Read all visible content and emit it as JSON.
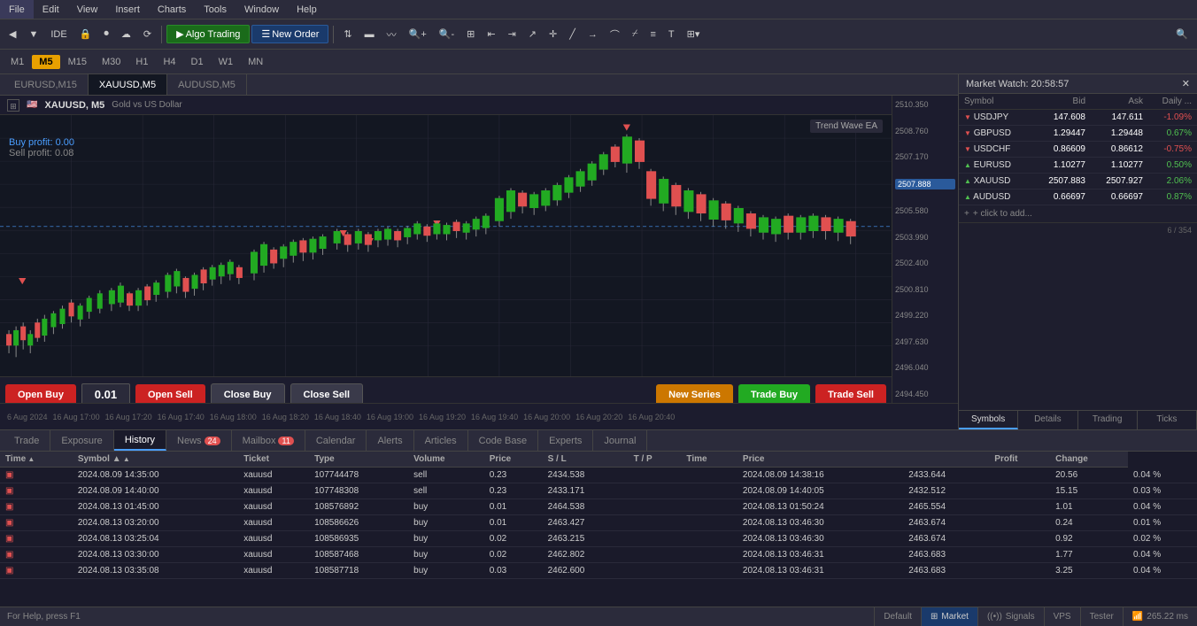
{
  "menubar": {
    "items": [
      "File",
      "Edit",
      "View",
      "Insert",
      "Charts",
      "Tools",
      "Window",
      "Help"
    ]
  },
  "toolbar": {
    "algo_trading": "Algo Trading",
    "new_order": "New Order"
  },
  "timeframes": {
    "items": [
      "M1",
      "M5",
      "M15",
      "M30",
      "H1",
      "H4",
      "D1",
      "W1",
      "MN"
    ],
    "active": "M5"
  },
  "chart": {
    "pair": "XAUUSD, M5",
    "full_name": "Gold vs US Dollar",
    "ea": "Trend Wave EA",
    "buy_profit_label": "Buy profit: 0.00",
    "sell_profit_label": "Sell profit: 0.08",
    "price_high": "2510.350",
    "price_levels": [
      "2510.350",
      "2508.760",
      "2507.170",
      "2505.580",
      "2503.990",
      "2502.400",
      "2500.810",
      "2499.220",
      "2497.630",
      "2496.040",
      "2494.450"
    ],
    "current_price": "2507.888",
    "timestamps": [
      "6 Aug 2024",
      "16 Aug 17:00",
      "16 Aug 17:20",
      "16 Aug 17:40",
      "16 Aug 18:00",
      "16 Aug 18:20",
      "16 Aug 18:40",
      "16 Aug 19:00",
      "16 Aug 19:20",
      "16 Aug 19:40",
      "16 Aug 20:00",
      "16 Aug 20:20",
      "16 Aug 20:40"
    ]
  },
  "chart_tabs": [
    {
      "label": "EURUSD,M15",
      "active": false
    },
    {
      "label": "XAUUSD,M5",
      "active": true
    },
    {
      "label": "AUDUSD,M5",
      "active": false
    }
  ],
  "action_bar": {
    "open_buy": "Open Buy",
    "lot_size": "0.01",
    "open_sell": "Open Sell",
    "close_buy": "Close Buy",
    "close_sell": "Close Sell",
    "new_series": "New Series",
    "trade_buy": "Trade Buy",
    "trade_sell": "Trade Sell"
  },
  "market_watch": {
    "title": "Market Watch: 20:58:57",
    "columns": [
      "Symbol",
      "Bid",
      "Ask",
      "Daily ..."
    ],
    "rows": [
      {
        "arrow": "down",
        "symbol": "USDJPY",
        "bid": "147.608",
        "ask": "147.611",
        "daily": "-1.09%",
        "color": "red"
      },
      {
        "arrow": "down",
        "symbol": "GBPUSD",
        "bid": "1.29447",
        "ask": "1.29448",
        "daily": "0.67%",
        "color": "green"
      },
      {
        "arrow": "down",
        "symbol": "USDCHF",
        "bid": "0.86609",
        "ask": "0.86612",
        "daily": "-0.75%",
        "color": "red"
      },
      {
        "arrow": "up",
        "symbol": "EURUSD",
        "bid": "1.10277",
        "ask": "1.10277",
        "daily": "0.50%",
        "color": "green"
      },
      {
        "arrow": "up",
        "symbol": "XAUUSD",
        "bid": "2507.883",
        "ask": "2507.927",
        "daily": "2.06%",
        "color": "green"
      },
      {
        "arrow": "up",
        "symbol": "AUDUSD",
        "bid": "0.66697",
        "ask": "0.66697",
        "daily": "0.87%",
        "color": "green"
      }
    ],
    "add_label": "+ click to add...",
    "page_info": "6 / 354",
    "tabs": [
      "Symbols",
      "Details",
      "Trading",
      "Ticks"
    ]
  },
  "bottom_panel": {
    "tabs": [
      {
        "label": "Trade",
        "active": false,
        "badge": null
      },
      {
        "label": "Exposure",
        "active": false,
        "badge": null
      },
      {
        "label": "History",
        "active": true,
        "badge": null
      },
      {
        "label": "News",
        "active": false,
        "badge": "24"
      },
      {
        "label": "Mailbox",
        "active": false,
        "badge": "11"
      },
      {
        "label": "Calendar",
        "active": false,
        "badge": null
      },
      {
        "label": "Alerts",
        "active": false,
        "badge": null
      },
      {
        "label": "Articles",
        "active": false,
        "badge": null
      },
      {
        "label": "Code Base",
        "active": false,
        "badge": null
      },
      {
        "label": "Experts",
        "active": false,
        "badge": null
      },
      {
        "label": "Journal",
        "active": false,
        "badge": null
      }
    ],
    "columns": [
      "Time",
      "Symbol",
      "Ticket",
      "Type",
      "Volume",
      "Price",
      "S / L",
      "T / P",
      "Time",
      "Price",
      "",
      "Profit",
      "Change"
    ],
    "rows": [
      {
        "icon": "▣",
        "time_open": "2024.08.09 14:35:00",
        "symbol": "xauusd",
        "ticket": "107744478",
        "type": "sell",
        "volume": "0.23",
        "price_open": "2434.538",
        "sl": "",
        "tp": "",
        "time_close": "2024.08.09 14:38:16",
        "price_close": "2433.644",
        "blank": "",
        "profit": "20.56",
        "change": "0.04 %"
      },
      {
        "icon": "▣",
        "time_open": "2024.08.09 14:40:00",
        "symbol": "xauusd",
        "ticket": "107748308",
        "type": "sell",
        "volume": "0.23",
        "price_open": "2433.171",
        "sl": "",
        "tp": "",
        "time_close": "2024.08.09 14:40:05",
        "price_close": "2432.512",
        "blank": "",
        "profit": "15.15",
        "change": "0.03 %"
      },
      {
        "icon": "▣",
        "time_open": "2024.08.13 01:45:00",
        "symbol": "xauusd",
        "ticket": "108576892",
        "type": "buy",
        "volume": "0.01",
        "price_open": "2464.538",
        "sl": "",
        "tp": "",
        "time_close": "2024.08.13 01:50:24",
        "price_close": "2465.554",
        "blank": "",
        "profit": "1.01",
        "change": "0.04 %"
      },
      {
        "icon": "▣",
        "time_open": "2024.08.13 03:20:00",
        "symbol": "xauusd",
        "ticket": "108586626",
        "type": "buy",
        "volume": "0.01",
        "price_open": "2463.427",
        "sl": "",
        "tp": "",
        "time_close": "2024.08.13 03:46:30",
        "price_close": "2463.674",
        "blank": "",
        "profit": "0.24",
        "change": "0.01 %"
      },
      {
        "icon": "▣",
        "time_open": "2024.08.13 03:25:04",
        "symbol": "xauusd",
        "ticket": "108586935",
        "type": "buy",
        "volume": "0.02",
        "price_open": "2463.215",
        "sl": "",
        "tp": "",
        "time_close": "2024.08.13 03:46:30",
        "price_close": "2463.674",
        "blank": "",
        "profit": "0.92",
        "change": "0.02 %"
      },
      {
        "icon": "▣",
        "time_open": "2024.08.13 03:30:00",
        "symbol": "xauusd",
        "ticket": "108587468",
        "type": "buy",
        "volume": "0.02",
        "price_open": "2462.802",
        "sl": "",
        "tp": "",
        "time_close": "2024.08.13 03:46:31",
        "price_close": "2463.683",
        "blank": "",
        "profit": "1.77",
        "change": "0.04 %"
      },
      {
        "icon": "▣",
        "time_open": "2024.08.13 03:35:08",
        "symbol": "xauusd",
        "ticket": "108587718",
        "type": "buy",
        "volume": "0.03",
        "price_open": "2462.600",
        "sl": "",
        "tp": "",
        "time_close": "2024.08.13 03:46:31",
        "price_close": "2463.683",
        "blank": "",
        "profit": "3.25",
        "change": "0.04 %"
      }
    ]
  },
  "status_bar": {
    "help_text": "For Help, press F1",
    "default_label": "Default",
    "market_label": "Market",
    "signals_label": "Signals",
    "vps_label": "VPS",
    "tester_label": "Tester",
    "ping": "265.22 ms"
  }
}
